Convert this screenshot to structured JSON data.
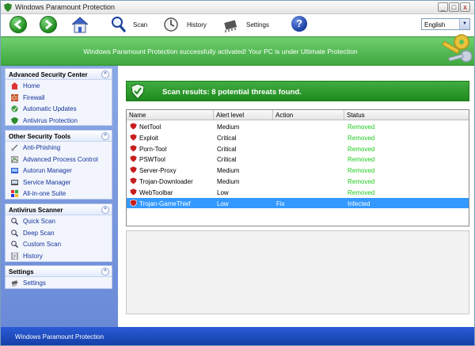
{
  "window": {
    "title": "Windows Paramount Protection",
    "minimize_glyph": "_",
    "maximize_glyph": "□",
    "close_glyph": "x"
  },
  "toolbar": {
    "back_icon": "back-arrow-icon",
    "forward_icon": "forward-arrow-icon",
    "home_icon": "home-icon",
    "scan_label": "Scan",
    "history_label": "History",
    "settings_label": "Settings",
    "help_glyph": "?",
    "language_value": "English",
    "dropdown_glyph": "▼"
  },
  "banner": {
    "message": "Windows Paramount Protection successfully activated! Your PC is under Ultimate Protection"
  },
  "sidebar": {
    "panels": [
      {
        "title": "Advanced Security Center",
        "items": [
          {
            "label": "Home",
            "icon": "home-icon"
          },
          {
            "label": "Firewall",
            "icon": "firewall-icon"
          },
          {
            "label": "Automatic Updates",
            "icon": "updates-icon"
          },
          {
            "label": "Antivirus Protection",
            "icon": "antivirus-icon"
          }
        ]
      },
      {
        "title": "Other Security Tools",
        "items": [
          {
            "label": "Anti-Phishing",
            "icon": "anti-phishing-icon"
          },
          {
            "label": "Advanced Process Control",
            "icon": "process-control-icon"
          },
          {
            "label": "Autorun Manager",
            "icon": "autorun-icon"
          },
          {
            "label": "Service Manager",
            "icon": "service-icon"
          },
          {
            "label": "All-in-one Suite",
            "icon": "suite-icon"
          }
        ]
      },
      {
        "title": "Antivirus Scanner",
        "items": [
          {
            "label": "Quick Scan",
            "icon": "quick-scan-icon"
          },
          {
            "label": "Deep Scan",
            "icon": "deep-scan-icon"
          },
          {
            "label": "Custom Scan",
            "icon": "custom-scan-icon"
          },
          {
            "label": "History",
            "icon": "history-icon"
          }
        ]
      },
      {
        "title": "Settings",
        "items": [
          {
            "label": "Settings",
            "icon": "settings-icon"
          }
        ]
      }
    ],
    "collapse_glyph": "^"
  },
  "results": {
    "headline": "Scan results: 8 potential threats found.",
    "columns": [
      "Name",
      "Alert level",
      "Action",
      "Status"
    ],
    "rows": [
      {
        "name": "NetTool",
        "alert": "Medium",
        "action": "",
        "status": "Removed"
      },
      {
        "name": "Exploit",
        "alert": "Critical",
        "action": "",
        "status": "Removed"
      },
      {
        "name": "Porn-Tool",
        "alert": "Critical",
        "action": "",
        "status": "Removed"
      },
      {
        "name": "PSWTool",
        "alert": "Critical",
        "action": "",
        "status": "Removed"
      },
      {
        "name": "Server-Proxy",
        "alert": "Medium",
        "action": "",
        "status": "Removed"
      },
      {
        "name": "Trojan-Downloader",
        "alert": "Medium",
        "action": "",
        "status": "Removed"
      },
      {
        "name": "WebToolbar",
        "alert": "Low",
        "action": "",
        "status": "Removed"
      },
      {
        "name": "Trojan-GameThief",
        "alert": "Low",
        "action": "Fix",
        "status": "Infected"
      }
    ]
  },
  "statusbar": {
    "text": "Windows Paramount Protection"
  },
  "colors": {
    "removed": "#22cc22",
    "selected_row": "#3399ff",
    "banner_green": "#4cb84c",
    "status_blue": "#1f4cc2"
  }
}
